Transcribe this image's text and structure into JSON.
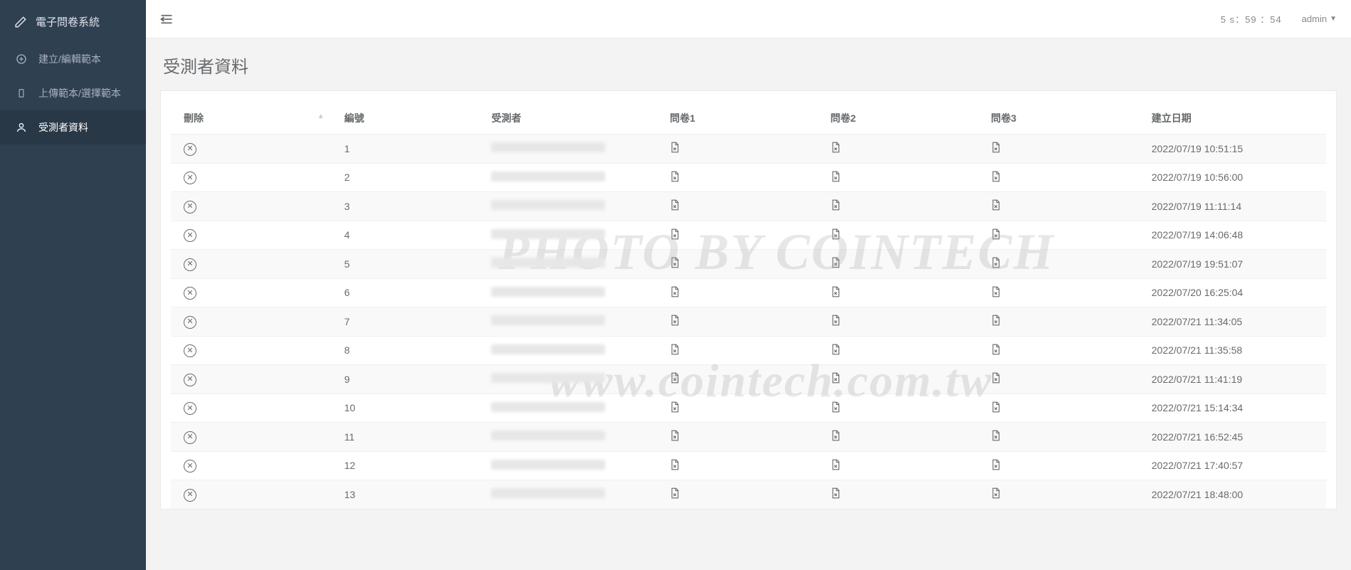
{
  "brand": "電子問卷系統",
  "sidebar": {
    "items": [
      {
        "label": "建立/編輯範本"
      },
      {
        "label": "上傳範本/選擇範本"
      },
      {
        "label": "受測者資料"
      }
    ]
  },
  "header": {
    "timer": "5 s：59 ：54",
    "user": "admin"
  },
  "page_title": "受測者資料",
  "table": {
    "headers": {
      "delete": "刪除",
      "no": "編號",
      "subject": "受測者",
      "q1": "問卷1",
      "q2": "問卷2",
      "q3": "問卷3",
      "created": "建立日期"
    },
    "rows": [
      {
        "no": "1",
        "created": "2022/07/19 10:51:15"
      },
      {
        "no": "2",
        "created": "2022/07/19 10:56:00"
      },
      {
        "no": "3",
        "created": "2022/07/19 11:11:14"
      },
      {
        "no": "4",
        "created": "2022/07/19 14:06:48"
      },
      {
        "no": "5",
        "created": "2022/07/19 19:51:07"
      },
      {
        "no": "6",
        "created": "2022/07/20 16:25:04"
      },
      {
        "no": "7",
        "created": "2022/07/21 11:34:05"
      },
      {
        "no": "8",
        "created": "2022/07/21 11:35:58"
      },
      {
        "no": "9",
        "created": "2022/07/21 11:41:19"
      },
      {
        "no": "10",
        "created": "2022/07/21 15:14:34"
      },
      {
        "no": "11",
        "created": "2022/07/21 16:52:45"
      },
      {
        "no": "12",
        "created": "2022/07/21 17:40:57"
      },
      {
        "no": "13",
        "created": "2022/07/21 18:48:00"
      }
    ]
  },
  "watermark": {
    "line1": "PHOTO BY COINTECH",
    "line2": "www.cointech.com.tw"
  }
}
